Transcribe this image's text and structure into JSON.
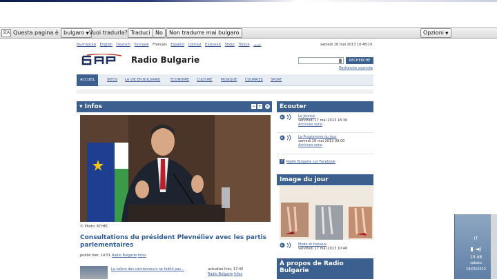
{
  "translate_bar": {
    "question": "Questa pagina è in",
    "source_language": "bulgaro",
    "prompt": "Vuoi tradurla?",
    "translate_button": "Traduci",
    "no_button": "No",
    "never_button": "Non tradurre mai bulgaro",
    "options_button": "Opzioni"
  },
  "languages": [
    "Български",
    "English",
    "Deutsch",
    "Русский",
    "Français",
    "Español",
    "Српски",
    "Ελληνικά",
    "Shqip",
    "Türkçe",
    "عربي"
  ],
  "current_language": "Français",
  "date_top": "samedi 18 mai 2013 10:48:10",
  "site": {
    "name": "Radio Bulgarie",
    "logo_text": "БНР"
  },
  "search": {
    "button": "RECHERCHE",
    "advanced": "Recherche avancée"
  },
  "nav": [
    "ACCUEIL",
    "INFOS",
    "LA VIE EN BULGARIE",
    "ECONOMIE",
    "CULTURE",
    "MUSIQUE",
    "COURRIES",
    "SPORT"
  ],
  "infos": {
    "title": "Infos",
    "credit": "© Photo: БГНЕС",
    "headline": "Consultations du président Plevnéliev avec les partis parlementaires",
    "meta_date": "publié hier, 14:51",
    "meta_source": "Radio Bulgarie",
    "meta_section": "Infos",
    "story2_title": "La colère des camionneurs ne faiblit pas...",
    "story2_date": "actualisé hier, 17:40",
    "story2_source": "Radio Bulgarie",
    "story2_section": "Infos"
  },
  "ecouter": {
    "title": "Ecouter",
    "items": [
      {
        "title": "Le Journal",
        "date": "vendredi 17 mai 2013 18:36",
        "archives": "Archives sono"
      },
      {
        "title": "Le Programme du Jour",
        "date": "samedi 18 mai 2013 09:00",
        "archives": "Archives sono"
      }
    ],
    "facebook": "Radio Bulgarie sur Facebook"
  },
  "image_du_jour": {
    "title": "Image du jour",
    "caption": "Mode et travaux",
    "date": "vendredi 17 mai 2013 10:46"
  },
  "apropos": {
    "title": "À propos de Radio Bulgarie"
  },
  "taskbar": {
    "lang": "IT",
    "time": "10:48",
    "day": "sabato",
    "date": "18/05/2013"
  }
}
